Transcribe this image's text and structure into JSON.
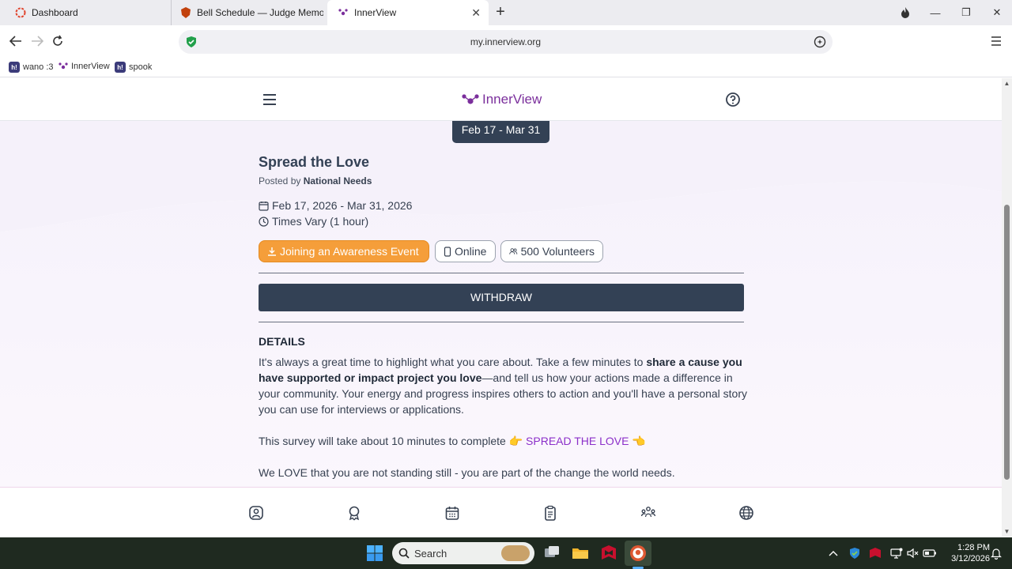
{
  "browser": {
    "tabs": [
      {
        "label": "Dashboard",
        "icon": "dashboard-ring-icon"
      },
      {
        "label": "Bell Schedule — Judge Memorial |",
        "icon": "school-crest-icon"
      },
      {
        "label": "InnerView",
        "icon": "innerview-logo-icon"
      }
    ],
    "url": "my.innerview.org",
    "bookmarks": [
      {
        "label": "wano :3",
        "badge": "h!"
      },
      {
        "label": "InnerView",
        "badge": ""
      },
      {
        "label": "spook",
        "badge": "h!"
      }
    ]
  },
  "app": {
    "logo_text": "InnerView",
    "date_pill": "Feb 17 - Mar 31"
  },
  "event": {
    "title": "Spread the Love",
    "posted_prefix": "Posted by",
    "posted_by": "National Needs",
    "date_range": "Feb 17, 2026 - Mar 31, 2026",
    "time": "Times Vary (1 hour)",
    "chips": {
      "category": "Joining an Awareness Event",
      "location": "Online",
      "volunteers": "500 Volunteers"
    },
    "withdraw_label": "WITHDRAW",
    "details_heading": "DETAILS",
    "details": {
      "p1_a": "It's always a great time to highlight what you care about. Take a few minutes to ",
      "p1_bold": "share a cause you have supported or impact project you love",
      "p1_b": "—and tell us how your actions made a difference in your community. Your energy and progress inspires others to action and you'll have a personal story you can use for interviews or applications.",
      "p2_a": "This survey will take about 10 minutes to complete ",
      "p2_emoji1": "👉",
      "p2_link": "SPREAD THE LOVE",
      "p2_emoji2": "👈",
      "p3": "We LOVE that you are not standing still - you are part of the change the world needs."
    }
  },
  "bottom_nav": [
    "profile",
    "achievements",
    "calendar",
    "tasks",
    "community",
    "explore"
  ],
  "taskbar": {
    "search_placeholder": "Search",
    "time": "1:28 PM",
    "date": "3/12/2026"
  },
  "colors": {
    "primary": "#334155",
    "brand": "#7b2f9c",
    "chip_orange": "#f59e3a",
    "link": "#8b2fc9"
  }
}
